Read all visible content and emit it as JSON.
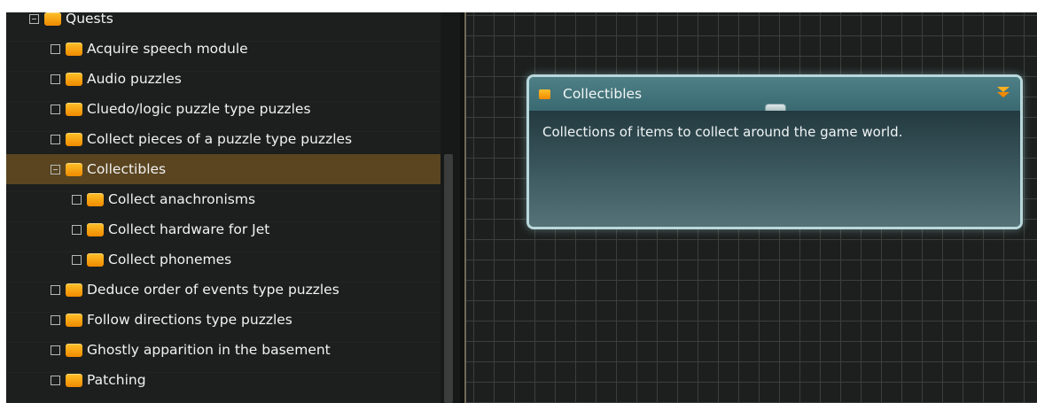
{
  "tree": {
    "items": [
      {
        "label": "Quests",
        "level": 0,
        "expander": "collapse"
      },
      {
        "label": "Acquire speech module",
        "level": 1,
        "expander": "leaf"
      },
      {
        "label": "Audio puzzles",
        "level": 1,
        "expander": "leaf"
      },
      {
        "label": "Cluedo/logic puzzle type puzzles",
        "level": 1,
        "expander": "leaf"
      },
      {
        "label": "Collect pieces of a puzzle type puzzles",
        "level": 1,
        "expander": "leaf"
      },
      {
        "label": "Collectibles",
        "level": 1,
        "expander": "collapse",
        "selected": true
      },
      {
        "label": "Collect anachronisms",
        "level": 2,
        "expander": "leaf"
      },
      {
        "label": "Collect hardware for Jet",
        "level": 2,
        "expander": "leaf"
      },
      {
        "label": "Collect phonemes",
        "level": 2,
        "expander": "leaf"
      },
      {
        "label": "Deduce order of events type puzzles",
        "level": 1,
        "expander": "leaf"
      },
      {
        "label": "Follow directions type puzzles",
        "level": 1,
        "expander": "leaf"
      },
      {
        "label": "Ghostly apparition in the basement",
        "level": 1,
        "expander": "leaf"
      },
      {
        "label": "Patching",
        "level": 1,
        "expander": "leaf"
      }
    ],
    "folder_icon": "folder-icon",
    "folder_color": "#ffb100",
    "selected_row_color": "#5a4520"
  },
  "node": {
    "title": "Collectibles",
    "description": "Collections of items to collect around the game world.",
    "icon": "folder-icon",
    "collapse_icon": "chevron-down-icon",
    "border_color": "#b9d8dc",
    "header_color": "#4e7f86",
    "accent_color": "#f5a623"
  }
}
